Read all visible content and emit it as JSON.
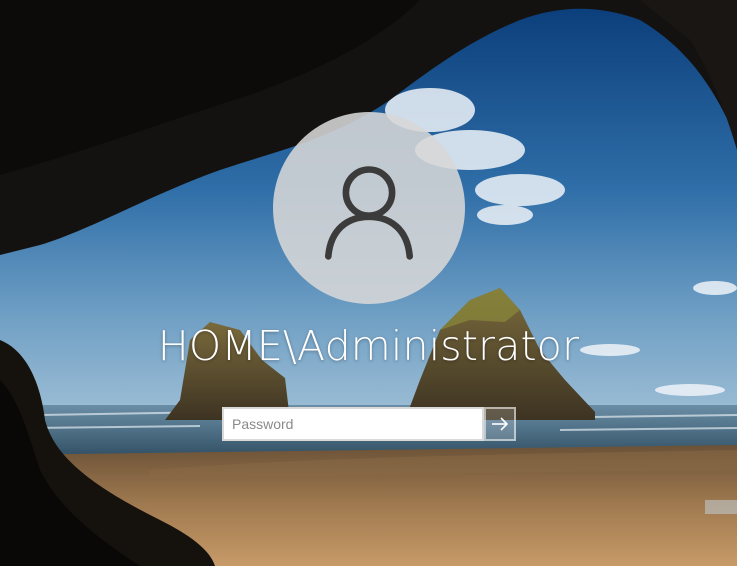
{
  "user": {
    "account_name": "HOME\\Administrator",
    "avatar_icon": "user-silhouette-icon"
  },
  "password_field": {
    "placeholder": "Password",
    "value": ""
  },
  "submit_button": {
    "icon": "arrow-right-icon"
  },
  "colors": {
    "avatar_background": "#d7d7d7",
    "text": "#ffffff",
    "field_border": "#d9d9d9"
  }
}
